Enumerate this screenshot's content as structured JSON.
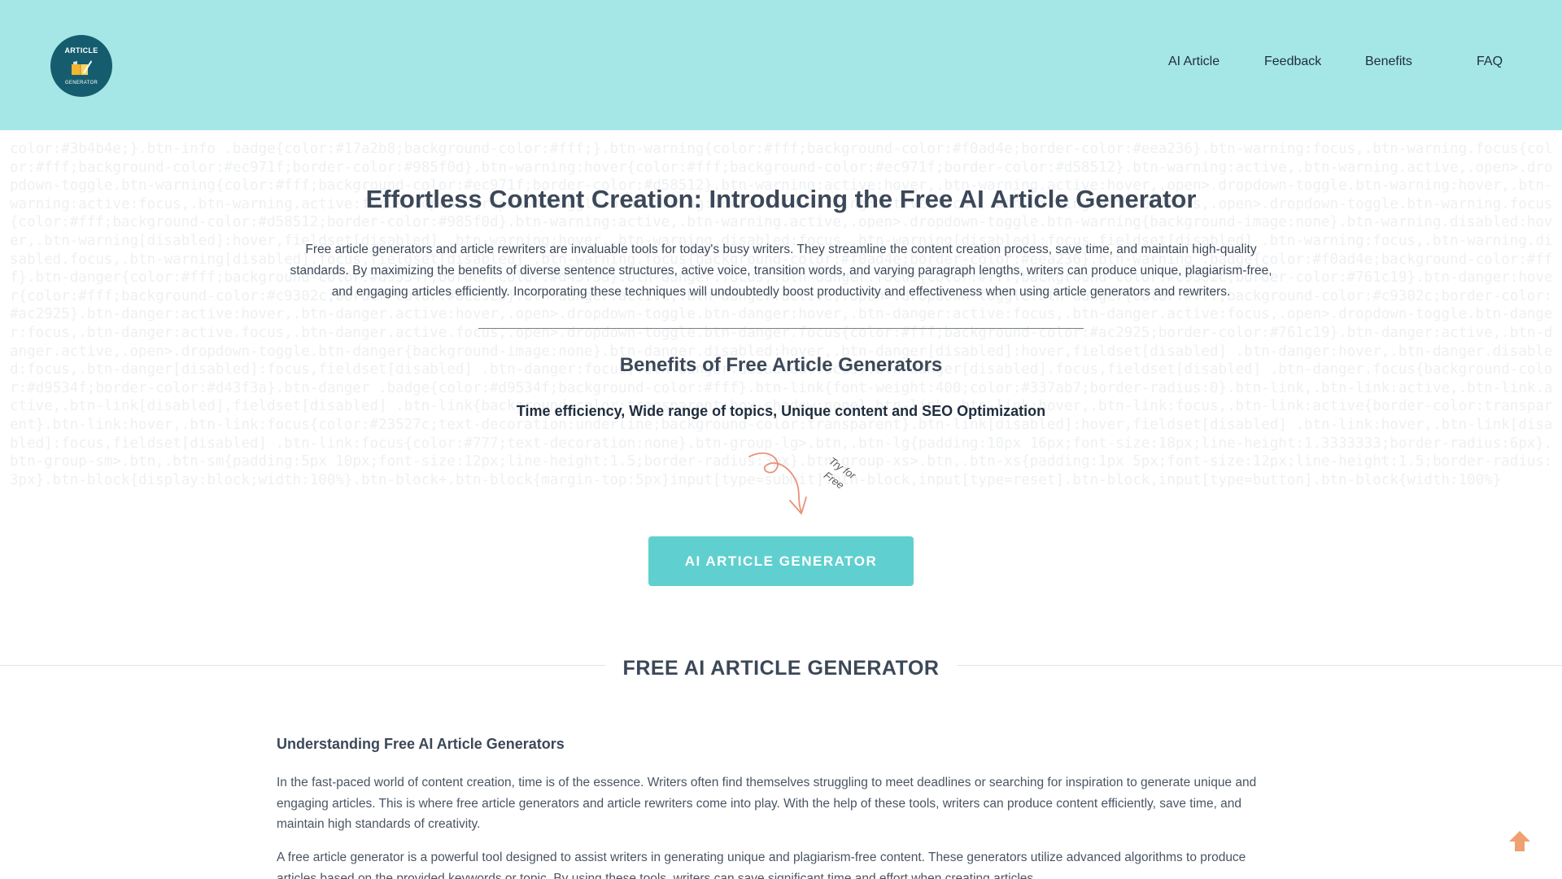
{
  "header": {
    "logo": {
      "top_text": "ARTICLE",
      "bottom_text": "GENERATOR",
      "icon": "book-quill-icon"
    },
    "nav": [
      {
        "label": "AI Article"
      },
      {
        "label": "Feedback"
      },
      {
        "label": "Benefits"
      },
      {
        "label": "FAQ"
      }
    ],
    "background": "#a5e7e6"
  },
  "hero": {
    "title": "Effortless Content Creation: Introducing the Free AI Article Generator",
    "description": "Free article generators and article rewriters are invaluable tools for today's busy writers. They streamline the content creation process, save time, and maintain high-quality standards. By maximizing the benefits of diverse sentence structures, active voice, transition words, and varying paragraph lengths, writers can produce unique, plagiarism-free, and engaging articles efficiently. Incorporating these techniques will undoubtedly boost productivity and effectiveness when using article generators and rewriters.",
    "benefits_title": "Benefits of Free Article Generators",
    "benefits_subtitle": "Time efficiency, Wide range of topics, Unique content and SEO Optimization",
    "doodle_text_1": "Try for",
    "doodle_text_2": "Free",
    "cta_label": "AI ARTICLE GENERATOR",
    "cta_color": "#5fd0cf",
    "code_watermark": "color:#3b4b4e;}.btn-info .badge{color:#17a2b8;background-color:#fff;}.btn-warning{color:#fff;background-color:#f0ad4e;border-color:#eea236}.btn-warning:focus,.btn-warning.focus{color:#fff;background-color:#ec971f;border-color:#985f0d}.btn-warning:hover{color:#fff;background-color:#ec971f;border-color:#d58512}.btn-warning:active,.btn-warning.active,.open>.dropdown-toggle.btn-warning{color:#fff;background-color:#ec971f;border-color:#d58512}.btn-warning:active:hover,.btn-warning.active:hover,.open>.dropdown-toggle.btn-warning:hover,.btn-warning:active:focus,.btn-warning.active:focus,.open>.dropdown-toggle.btn-warning:focus,.btn-warning:active.focus,.btn-warning.active.focus,.open>.dropdown-toggle.btn-warning.focus{color:#fff;background-color:#d58512;border-color:#985f0d}.btn-warning:active,.btn-warning.active,.open>.dropdown-toggle.btn-warning{background-image:none}.btn-warning.disabled:hover,.btn-warning[disabled]:hover,fieldset[disabled] .btn-warning:hover,.btn-warning.disabled:focus,.btn-warning[disabled]:focus,fieldset[disabled] .btn-warning:focus,.btn-warning.disabled.focus,.btn-warning[disabled].focus,fieldset[disabled] .btn-warning.focus{background-color:#f0ad4e;border-color:#eea236}.btn-warning .badge{color:#f0ad4e;background-color:#fff}.btn-danger{color:#fff;background-color:#d9534f;border-color:#d43f3a}.btn-danger:focus,.btn-danger.focus{color:#fff;background-color:#c9302c;border-color:#761c19}.btn-danger:hover{color:#fff;background-color:#c9302c;border-color:#ac2925}.btn-danger:active,.btn-danger.active,.open>.dropdown-toggle.btn-danger{color:#fff;background-color:#c9302c;border-color:#ac2925}.btn-danger:active:hover,.btn-danger.active:hover,.open>.dropdown-toggle.btn-danger:hover,.btn-danger:active:focus,.btn-danger.active:focus,.open>.dropdown-toggle.btn-danger:focus,.btn-danger:active.focus,.btn-danger.active.focus,.open>.dropdown-toggle.btn-danger.focus{color:#fff;background-color:#ac2925;border-color:#761c19}.btn-danger:active,.btn-danger.active,.open>.dropdown-toggle.btn-danger{background-image:none}.btn-danger.disabled:hover,.btn-danger[disabled]:hover,fieldset[disabled] .btn-danger:hover,.btn-danger.disabled:focus,.btn-danger[disabled]:focus,fieldset[disabled] .btn-danger:focus,.btn-danger.disabled.focus,.btn-danger[disabled].focus,fieldset[disabled] .btn-danger.focus{background-color:#d9534f;border-color:#d43f3a}.btn-danger .badge{color:#d9534f;background-color:#fff}.btn-link{font-weight:400;color:#337ab7;border-radius:0}.btn-link,.btn-link:active,.btn-link.active,.btn-link[disabled],fieldset[disabled] .btn-link{background-color:transparent;box-shadow:none}.btn-link,.btn-link:hover,.btn-link:focus,.btn-link:active{border-color:transparent}.btn-link:hover,.btn-link:focus{color:#23527c;text-decoration:underline;background-color:transparent}.btn-link[disabled]:hover,fieldset[disabled] .btn-link:hover,.btn-link[disabled]:focus,fieldset[disabled] .btn-link:focus{color:#777;text-decoration:none}.btn-group-lg>.btn,.btn-lg{padding:10px 16px;font-size:18px;line-height:1.3333333;border-radius:6px}.btn-group-sm>.btn,.btn-sm{padding:5px 10px;font-size:12px;line-height:1.5;border-radius:3px}.btn-group-xs>.btn,.btn-xs{padding:1px 5px;font-size:12px;line-height:1.5;border-radius:3px}.btn-block{display:block;width:100%}.btn-block+.btn-block{margin-top:5px}input[type=submit].btn-block,input[type=reset].btn-block,input[type=button].btn-block{width:100%}"
  },
  "section": {
    "title": "FREE AI ARTICLE GENERATOR"
  },
  "article": {
    "heading": "Understanding Free AI Article Generators",
    "paragraph_1": "In the fast-paced world of content creation, time is of the essence. Writers often find themselves struggling to meet deadlines or searching for inspiration to generate unique and engaging articles. This is where free article generators and article rewriters come into play. With the help of these tools, writers can produce content efficiently, save time, and maintain high standards of creativity.",
    "paragraph_2": "A free article generator is a powerful tool designed to assist writers in generating unique and plagiarism-free content. These generators utilize advanced algorithms to produce articles based on the provided keywords or topic. By using these tools, writers can save significant time and effort when creating articles."
  },
  "scroll_top": {
    "icon": "arrow-up-icon",
    "color": "#f0a070"
  }
}
